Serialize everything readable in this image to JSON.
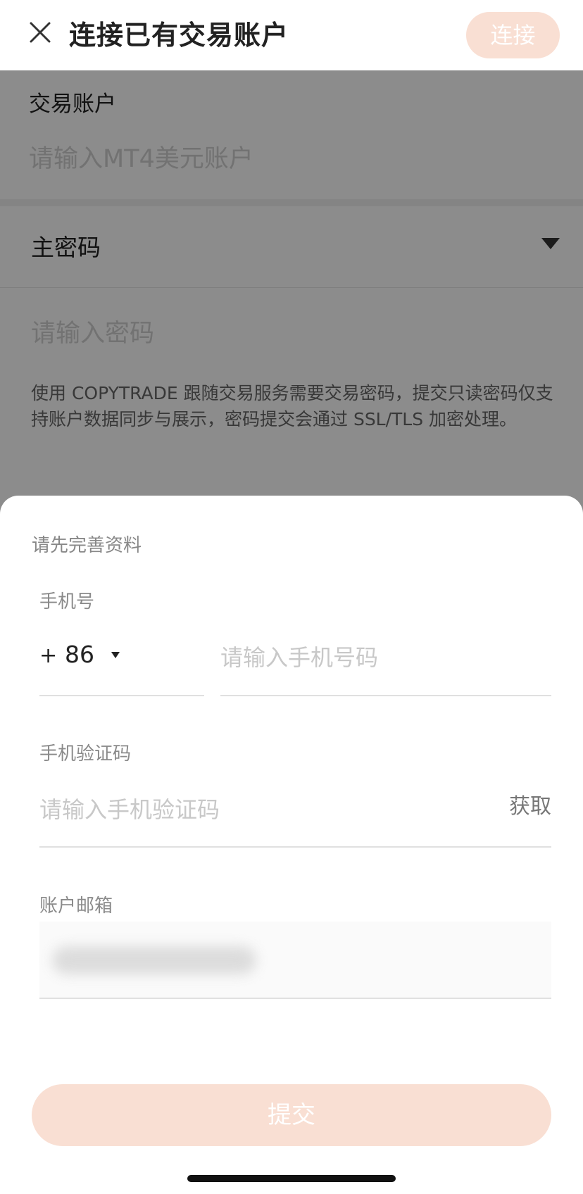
{
  "header": {
    "title": "连接已有交易账户",
    "connect_label": "连接",
    "close_icon": "close-icon"
  },
  "form": {
    "account_label": "交易账户",
    "account_placeholder": "请输入MT4美元账户",
    "password_type_label": "主密码",
    "password_placeholder": "请输入密码",
    "notice": "使用 COPYTRADE 跟随交易服务需要交易密码，提交只读密码仅支持账户数据同步与展示，密码提交会通过 SSL/TLS 加密处理。"
  },
  "sheet": {
    "title": "请先完善资料",
    "phone_label": "手机号",
    "country_code_plus": "+",
    "country_code": "86",
    "phone_placeholder": "请输入手机号码",
    "code_label": "手机验证码",
    "code_placeholder": "请输入手机验证码",
    "get_code_label": "获取",
    "email_label": "账户邮箱",
    "submit_label": "提交"
  },
  "colors": {
    "accent_disabled": "#f9dfd3",
    "overlay": "rgba(0,0,0,0.45)"
  }
}
